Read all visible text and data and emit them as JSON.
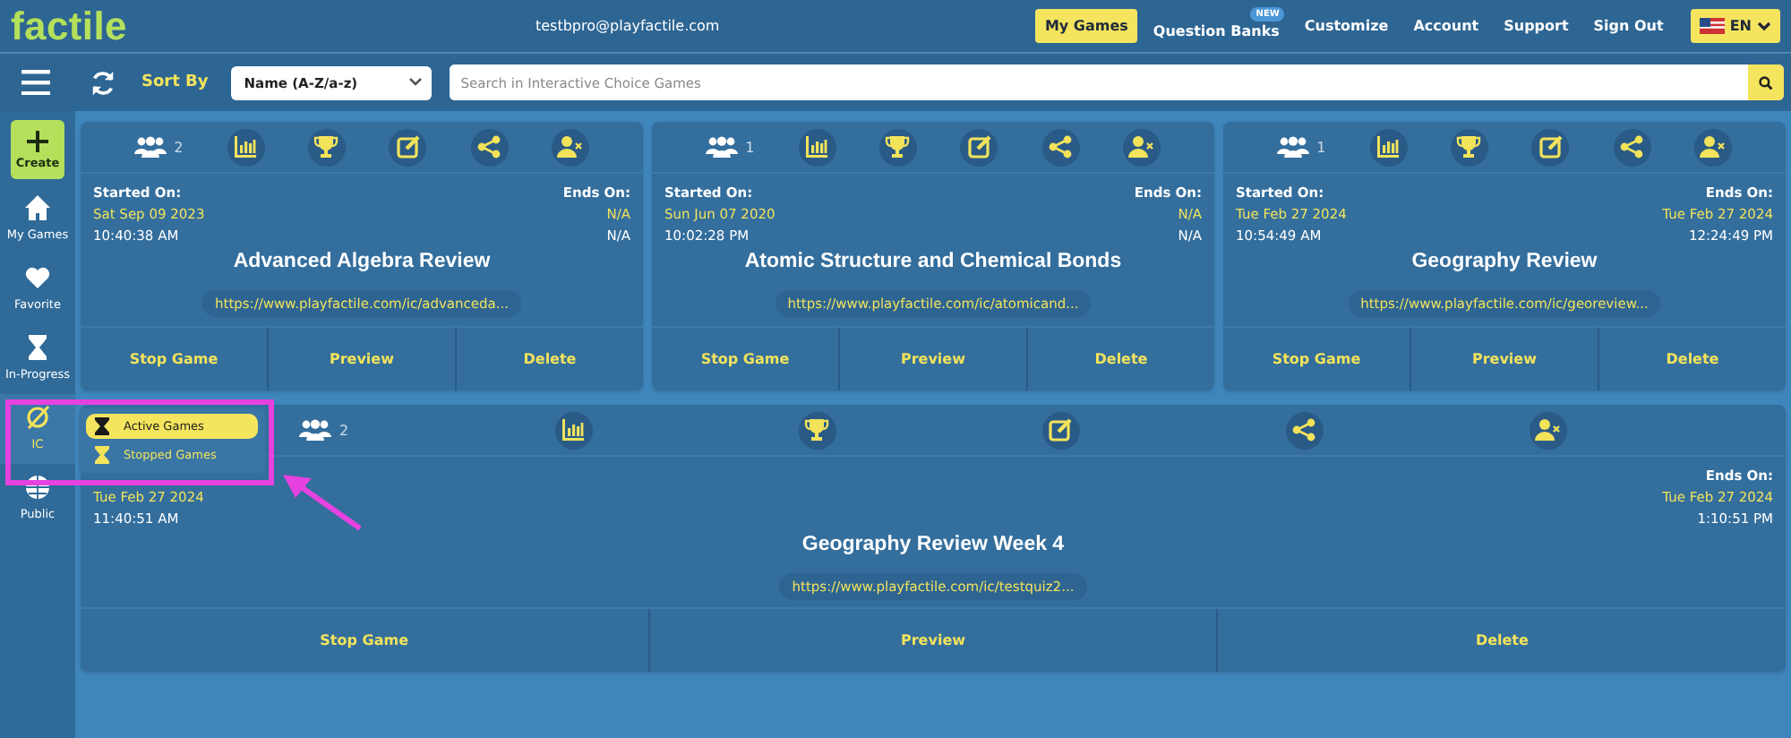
{
  "header": {
    "logo": "factile",
    "email": "testbpro@playfactile.com",
    "nav": [
      {
        "label": "My Games",
        "selected": true
      },
      {
        "label": "Question Banks",
        "selected": false,
        "badge": "NEW"
      },
      {
        "label": "Customize",
        "selected": false
      },
      {
        "label": "Account",
        "selected": false
      },
      {
        "label": "Support",
        "selected": false
      },
      {
        "label": "Sign Out",
        "selected": false
      }
    ],
    "language": "EN"
  },
  "toolbar": {
    "sort_label": "Sort By",
    "sort_value": "Name (A-Z/a-z)",
    "search": {
      "placeholder": "Search in Interactive Choice Games"
    }
  },
  "sidebar": {
    "items": [
      {
        "kind": "create",
        "label": "Create",
        "selected": false
      },
      {
        "kind": "home",
        "label": "My Games",
        "selected": false
      },
      {
        "kind": "heart",
        "label": "Favorite",
        "selected": false
      },
      {
        "kind": "hourglass",
        "label": "In-Progress",
        "selected": false
      },
      {
        "kind": "ic",
        "label": "IC",
        "selected": true
      },
      {
        "kind": "globe",
        "label": "Public",
        "selected": false
      }
    ]
  },
  "ic_menu": {
    "items": [
      {
        "label": "Active Games",
        "selected": true
      },
      {
        "label": "Stopped Games",
        "selected": false
      }
    ]
  },
  "games": [
    {
      "players": "2",
      "started_label": "Started On:",
      "started_date": "Sat Sep 09 2023",
      "started_time": "10:40:38 AM",
      "ends_label": "Ends On:",
      "ends_date": "N/A",
      "ends_time": "N/A",
      "title": "Advanced Algebra Review",
      "url": "https://www.playfactile.com/ic/advanceda...",
      "actions": [
        "Stop Game",
        "Preview",
        "Delete"
      ]
    },
    {
      "players": "1",
      "started_label": "Started On:",
      "started_date": "Sun Jun 07 2020",
      "started_time": "10:02:28 PM",
      "ends_label": "Ends On:",
      "ends_date": "N/A",
      "ends_time": "N/A",
      "title": "Atomic Structure and Chemical Bonds",
      "url": "https://www.playfactile.com/ic/atomicand...",
      "actions": [
        "Stop Game",
        "Preview",
        "Delete"
      ]
    },
    {
      "players": "1",
      "started_label": "Started On:",
      "started_date": "Tue Feb 27 2024",
      "started_time": "10:54:49 AM",
      "ends_label": "Ends On:",
      "ends_date": "Tue Feb 27 2024",
      "ends_time": "12:24:49 PM",
      "title": "Geography Review",
      "url": "https://www.playfactile.com/ic/georeview...",
      "actions": [
        "Stop Game",
        "Preview",
        "Delete"
      ]
    },
    {
      "players": "2",
      "started_date": "Tue Feb 27 2024",
      "started_time": "11:40:51 AM",
      "ends_label": "Ends On:",
      "ends_date": "Tue Feb 27 2024",
      "ends_time": "1:10:51 PM",
      "title": "Geography Review Week 4",
      "url": "https://www.playfactile.com/ic/testquiz2...",
      "actions": [
        "Stop Game",
        "Preview",
        "Delete"
      ]
    }
  ]
}
